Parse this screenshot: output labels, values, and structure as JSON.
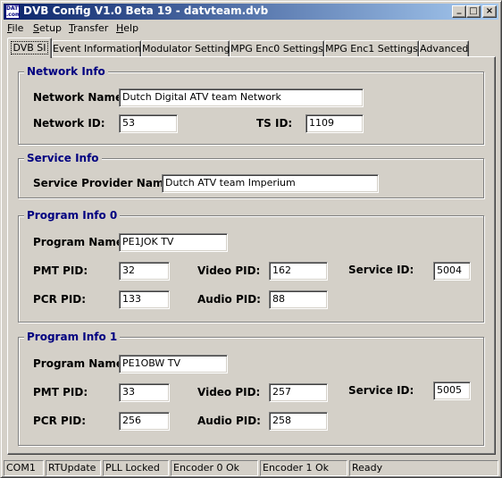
{
  "window": {
    "icon_text_top": "DATV",
    "icon_text_bottom": ".com",
    "title": "DVB Config V1.0 Beta 19 - datvteam.dvb",
    "minimize_glyph": "_",
    "maximize_glyph": "□",
    "close_glyph": "×"
  },
  "menu": [
    {
      "hotkey": "F",
      "rest": "ile"
    },
    {
      "hotkey": "S",
      "rest": "etup"
    },
    {
      "hotkey": "T",
      "rest": "ransfer"
    },
    {
      "hotkey": "H",
      "rest": "elp"
    }
  ],
  "tabs": [
    "DVB SI",
    "Event Information",
    "Modulator Settings",
    "MPG Enc0 Settings",
    "MPG Enc1 Settings",
    "Advanced"
  ],
  "active_tab": "DVB SI",
  "network": {
    "legend": "Network Info",
    "name_label": "Network Name:",
    "name_value": "Dutch Digital ATV team Network",
    "id_label": "Network ID:",
    "id_value": "53",
    "tsid_label": "TS ID:",
    "tsid_value": "1109"
  },
  "service": {
    "legend": "Service Info",
    "provider_label": "Service Provider Name:",
    "provider_value": "Dutch ATV team Imperium"
  },
  "program0": {
    "legend": "Program Info 0",
    "name_label": "Program Name:",
    "name_value": "PE1JOK TV",
    "pmt_label": "PMT PID:",
    "pmt_value": "32",
    "video_label": "Video PID:",
    "video_value": "162",
    "service_label": "Service ID:",
    "service_value": "5004",
    "pcr_label": "PCR PID:",
    "pcr_value": "133",
    "audio_label": "Audio PID:",
    "audio_value": "88"
  },
  "program1": {
    "legend": "Program Info 1",
    "name_label": "Program Name:",
    "name_value": "PE1OBW TV",
    "pmt_label": "PMT PID:",
    "pmt_value": "33",
    "video_label": "Video PID:",
    "video_value": "257",
    "service_label": "Service ID:",
    "service_value": "5005",
    "pcr_label": "PCR PID:",
    "pcr_value": "256",
    "audio_label": "Audio PID:",
    "audio_value": "258"
  },
  "status": [
    "COM1",
    "RTUpdate",
    "PLL Locked",
    "Encoder 0 Ok",
    "Encoder 1 Ok",
    "Ready"
  ],
  "colors": {
    "face": "#d4d0c8",
    "title_start": "#0a246a",
    "title_end": "#a6caf0",
    "legend": "#000080"
  }
}
